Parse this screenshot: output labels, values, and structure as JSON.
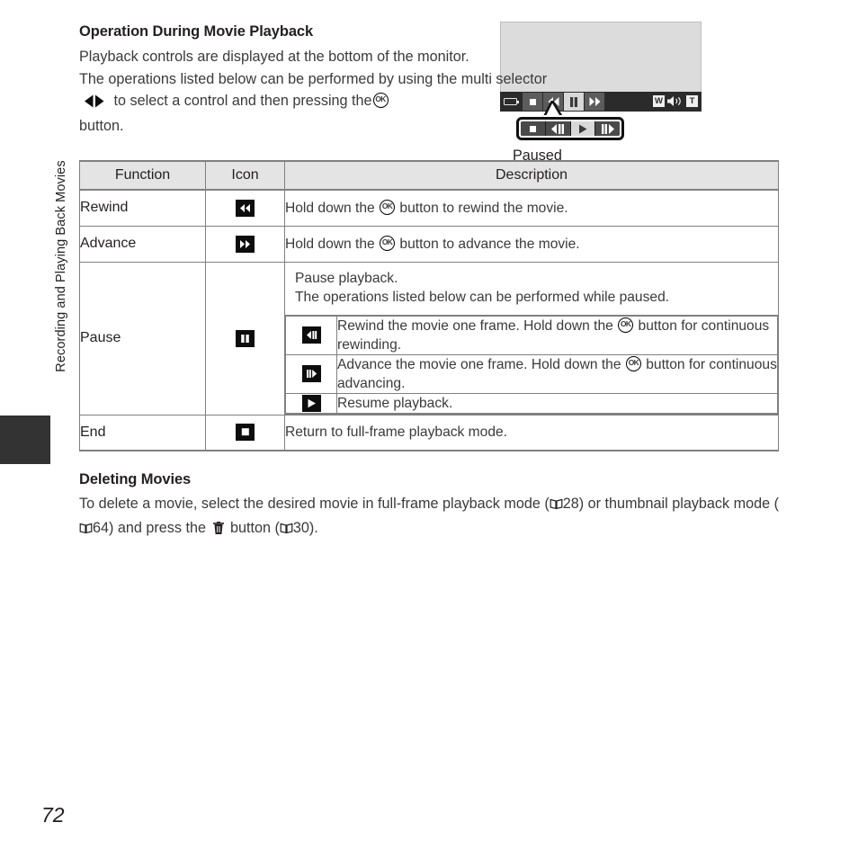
{
  "sidebar": {
    "chapter_label": "Recording and Playing Back Movies"
  },
  "page": {
    "number": "72"
  },
  "intro": {
    "heading": "Operation During Movie Playback",
    "line1": "Playback controls are displayed at the bottom of the monitor.",
    "line2_a": "The operations listed below can be performed by using the",
    "line2_b": "multi selector",
    "line2_c": "to select a control and then pressing the",
    "line2_d": "button."
  },
  "monitor": {
    "caption": "Paused",
    "bar_buttons": [
      {
        "icon": "stop-icon",
        "selected": false
      },
      {
        "icon": "rewind-icon",
        "selected": false
      },
      {
        "icon": "pause-icon",
        "selected": true
      },
      {
        "icon": "advance-icon",
        "selected": false
      }
    ],
    "volume": {
      "wide_label": "W",
      "tele_label": "T",
      "speaker_icon": "speaker-icon"
    },
    "battery_icon": "battery-icon",
    "callout_buttons": [
      {
        "icon": "stop-icon",
        "selected": false
      },
      {
        "icon": "frame-rewind-icon",
        "selected": false
      },
      {
        "icon": "play-icon",
        "selected": true
      },
      {
        "icon": "frame-advance-icon",
        "selected": false
      }
    ]
  },
  "table": {
    "headers": {
      "function": "Function",
      "icon": "Icon",
      "description": "Description"
    },
    "rows": [
      {
        "function": "Rewind",
        "icon": "rewind-icon",
        "desc_a": "Hold down the",
        "desc_b": "button to rewind the movie."
      },
      {
        "function": "Advance",
        "icon": "advance-icon",
        "desc_a": "Hold down the",
        "desc_b": "button to advance the movie."
      },
      {
        "function": "Pause",
        "icon": "pause-icon",
        "desc_line1": "Pause playback.",
        "desc_line2": "The operations listed below can be performed while paused.",
        "sub_rows": [
          {
            "icon": "frame-rewind-icon",
            "desc_a": "Rewind the movie one frame. Hold down the",
            "desc_b": "button for continuous rewinding."
          },
          {
            "icon": "frame-advance-icon",
            "desc_a": "Advance the movie one frame. Hold down the",
            "desc_b": "button for continuous advancing."
          },
          {
            "icon": "play-icon",
            "desc_a": "Resume playback.",
            "desc_b": ""
          }
        ]
      },
      {
        "function": "End",
        "icon": "stop-icon",
        "desc_a": "Return to full-frame playback mode.",
        "desc_b": ""
      }
    ]
  },
  "deleting": {
    "heading": "Deleting Movies",
    "text_a": "To delete a movie, select the desired movie in full-frame playback mode (",
    "ref1": "28",
    "text_b": ") or thumbnail playback mode (",
    "ref2": "64",
    "text_c": ") and press the",
    "text_d": "button (",
    "ref3": "30",
    "text_e": ")."
  },
  "colors": {
    "text": "#231f20",
    "body_text": "#3a3a3a",
    "table_border": "#808080",
    "header_bg": "#e4e4e4",
    "tab_black": "#333333",
    "monitor_screen": "#dcdcdc",
    "monitor_bar": "#2b2b2b",
    "selected_button": "#d8d8d8"
  }
}
